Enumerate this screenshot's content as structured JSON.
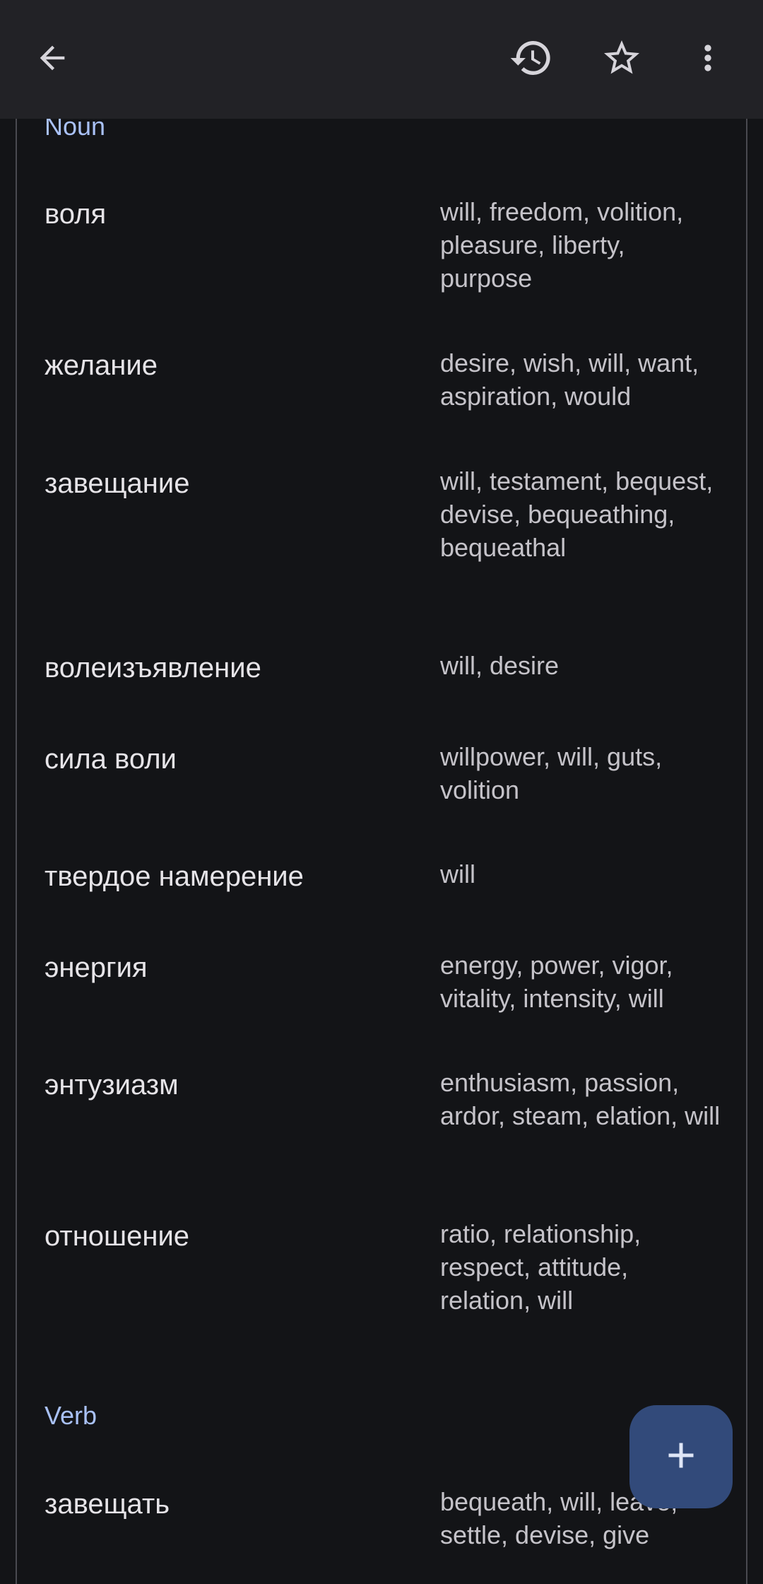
{
  "toolbar": {
    "back_icon": "arrow-left-icon",
    "history_icon": "history-icon",
    "star_icon": "star-outline-icon",
    "more_icon": "more-vert-icon"
  },
  "sections": [
    {
      "label": "Noun",
      "entries": [
        {
          "term": "воля",
          "translations": "will, freedom, volition, pleasure, liberty, purpose"
        },
        {
          "term": "желание",
          "translations": "desire, wish, will, want, aspiration, would"
        },
        {
          "term": "завещание",
          "translations": "will, testament, bequest, devise, bequeathing, bequeathal"
        },
        {
          "term": "волеизъявление",
          "translations": "will, desire"
        },
        {
          "term": "сила воли",
          "translations": "willpower, will, guts, volition"
        },
        {
          "term": "твердое намерение",
          "translations": "will"
        },
        {
          "term": "энергия",
          "translations": "energy, power, vigor, vitality, intensity, will"
        },
        {
          "term": "энтузиазм",
          "translations": "enthusiasm, passion, ardor, steam, elation, will"
        },
        {
          "term": "отношение",
          "translations": "ratio, relationship, respect, attitude, relation, will"
        }
      ]
    },
    {
      "label": "Verb",
      "entries": [
        {
          "term": "завещать",
          "translations": "bequeath, will, leave, settle, devise, give"
        }
      ]
    }
  ],
  "fab": {
    "icon": "plus-icon"
  },
  "colors": {
    "background": "#131417",
    "toolbar": "#222226",
    "section_label": "#a9c1f7",
    "fab": "#324a7a"
  }
}
